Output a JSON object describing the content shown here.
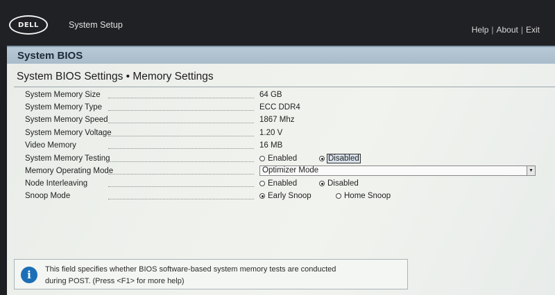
{
  "app": {
    "logo_text": "DELL",
    "title": "System Setup",
    "links": [
      "Help",
      "About",
      "Exit"
    ],
    "separator": "|"
  },
  "panel": {
    "title": "System BIOS",
    "section_title": "System BIOS Settings • Memory Settings"
  },
  "settings": [
    {
      "label": "System Memory Size",
      "value": "64 GB"
    },
    {
      "label": "System Memory Type",
      "value": "ECC DDR4"
    },
    {
      "label": "System Memory Speed",
      "value": "1867 Mhz"
    },
    {
      "label": "System Memory Voltage",
      "value": "1.20 V"
    },
    {
      "label": "Video Memory",
      "value": "16 MB"
    },
    {
      "label": "System Memory Testing",
      "options": [
        "Enabled",
        "Disabled"
      ],
      "selected": "Disabled"
    },
    {
      "label": "Memory Operating Mode",
      "value": "Optimizer Mode"
    },
    {
      "label": "Node Interleaving",
      "options": [
        "Enabled",
        "Disabled"
      ],
      "selected": "Disabled"
    },
    {
      "label": "Snoop Mode",
      "options": [
        "Early Snoop",
        "Home Snoop"
      ],
      "selected": "Early Snoop"
    }
  ],
  "help": {
    "icon": "info-icon",
    "text_line1": "This field specifies whether BIOS software-based system memory tests are conducted",
    "text_line2": "during POST. (Press <F1> for more help)"
  },
  "colors": {
    "topbar": "#202124",
    "panel_header": "#b1c3d1",
    "info_icon": "#1c6fb7"
  }
}
